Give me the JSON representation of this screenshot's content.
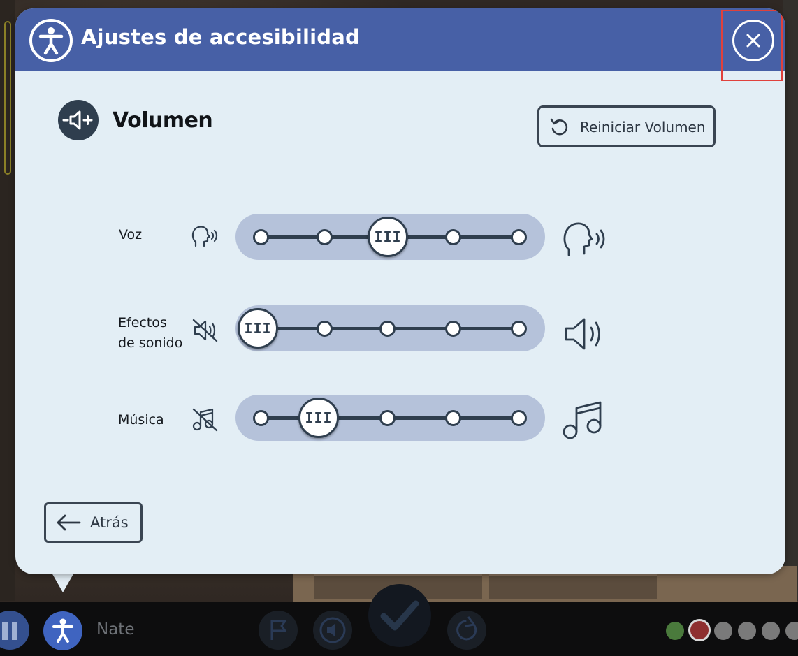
{
  "modal": {
    "title": "Ajustes de accesibilidad",
    "section_title": "Volumen",
    "reset_label": "Reiniciar Volumen",
    "back_label": "Atrás"
  },
  "sliders": [
    {
      "label": "Voz",
      "label_lines": [
        "Voz"
      ],
      "steps": 5,
      "selected_index": 2,
      "low_icon": "voice-low-icon",
      "high_icon": "voice-high-icon"
    },
    {
      "label": "Efectos de sonido",
      "label_lines": [
        "Efectos",
        "de sonido"
      ],
      "steps": 5,
      "selected_index": 0,
      "low_icon": "sound-muted-icon",
      "high_icon": "speaker-loud-icon"
    },
    {
      "label": "Música",
      "label_lines": [
        "Música"
      ],
      "steps": 5,
      "selected_index": 1,
      "low_icon": "music-muted-icon",
      "high_icon": "music-note-icon"
    }
  ],
  "thumb_glyph": "III",
  "bottom_bar": {
    "player_name": "Nate",
    "progress_dots": [
      "#4a7a3c",
      "#8e2f2f",
      "#777777",
      "#777777",
      "#777777",
      "#777777"
    ]
  },
  "colors": {
    "header": "#4760a6",
    "modal_bg": "#e3eef5",
    "track": "#b5c2da",
    "dark": "#2f3e4e",
    "close_highlight": "#e0413c"
  }
}
